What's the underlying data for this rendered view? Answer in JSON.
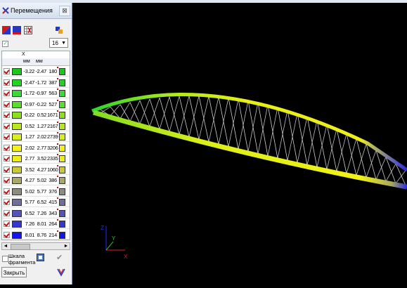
{
  "window": {
    "title": "Перемещения",
    "close_glyph": "⊠"
  },
  "toolbar": {
    "icons": [
      "color-scheme-icon",
      "blue-fill-icon",
      "table-settings-icon",
      "export-icon"
    ]
  },
  "options": {
    "count_value": "16",
    "count_arrow": "▼",
    "show_checkbox_mark": "✓"
  },
  "table": {
    "axis_label": "X",
    "units": [
      "мм",
      "мм"
    ],
    "rows": [
      {
        "from": "-3.22",
        "to": "-2.47",
        "count": "180",
        "color": "#19c819"
      },
      {
        "from": "-2.47",
        "to": "-1.72",
        "count": "387",
        "color": "#21d421"
      },
      {
        "from": "-1.72",
        "to": "-0.97",
        "count": "563",
        "color": "#3ad83a"
      },
      {
        "from": "-0.97",
        "to": "-0.22",
        "count": "527",
        "color": "#5ddc2e"
      },
      {
        "from": "-0.22",
        "to": "0.52",
        "count": "1671",
        "color": "#8de01e"
      },
      {
        "from": "0.52",
        "to": "1.27",
        "count": "2167",
        "color": "#b6e81c"
      },
      {
        "from": "1.27",
        "to": "2.02",
        "count": "2739",
        "color": "#d7f01a"
      },
      {
        "from": "2.02",
        "to": "2.77",
        "count": "3206",
        "color": "#f3f214"
      },
      {
        "from": "2.77",
        "to": "3.52",
        "count": "2335",
        "color": "#eeee1a"
      },
      {
        "from": "3.52",
        "to": "4.27",
        "count": "1060",
        "color": "#c9c93a"
      },
      {
        "from": "4.27",
        "to": "5.02",
        "count": "386",
        "color": "#a8a86a"
      },
      {
        "from": "5.02",
        "to": "5.77",
        "count": "376",
        "color": "#8c8c80"
      },
      {
        "from": "5.77",
        "to": "6.52",
        "count": "415",
        "color": "#6f6f9a"
      },
      {
        "from": "6.52",
        "to": "7.26",
        "count": "343",
        "color": "#5353b8"
      },
      {
        "from": "7.26",
        "to": "8.01",
        "count": "264",
        "color": "#3535d4"
      },
      {
        "from": "8.01",
        "to": "8.76",
        "count": "214",
        "color": "#1414ee"
      }
    ]
  },
  "scroll": {
    "left": "◄",
    "right": "►"
  },
  "footer": {
    "fragment_scale_label": "Шкала фрагмента",
    "close_label": "Закрыть",
    "apply_glyph": "✔"
  },
  "viewport": {
    "axes": {
      "z": "Z",
      "y": "Y",
      "x": "X"
    },
    "colors": {
      "axis_x": "#e02020",
      "axis_y": "#20c020",
      "axis_z": "#2030ff"
    }
  }
}
